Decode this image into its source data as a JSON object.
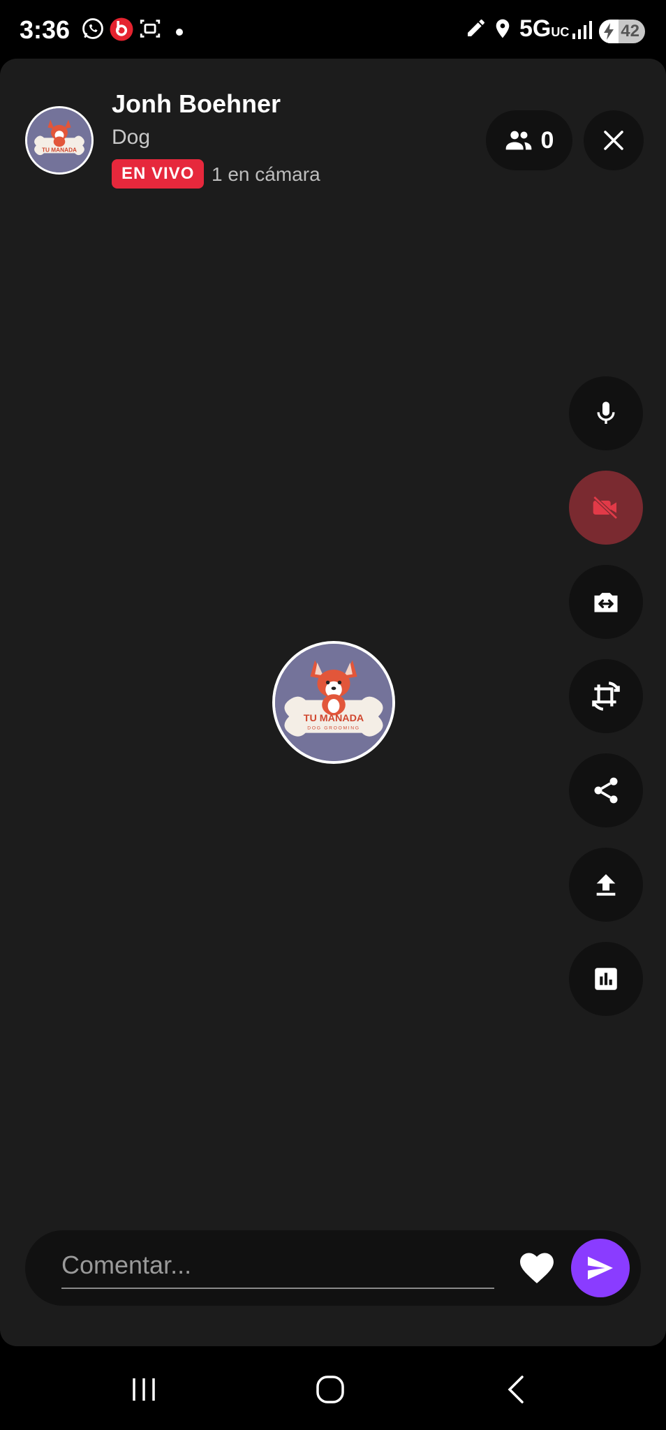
{
  "status_bar": {
    "time": "3:36",
    "network": "5G",
    "network_sub": "UC",
    "battery_level": "42",
    "battery_fraction": 0.42
  },
  "header": {
    "host_name": "Jonh Boehner",
    "host_category": "Dog",
    "live_label": "EN VIVO",
    "camera_count": "1 en cámara",
    "viewer_count": "0"
  },
  "logo": {
    "brand": "TU MANADA",
    "tagline": "DOG GROOMING"
  },
  "side_controls": [
    {
      "name": "microphone-button",
      "icon": "microphone-icon"
    },
    {
      "name": "camera-off-button",
      "icon": "video-off-icon"
    },
    {
      "name": "switch-camera-button",
      "icon": "camera-switch-icon"
    },
    {
      "name": "rotate-button",
      "icon": "crop-rotate-icon"
    },
    {
      "name": "share-button",
      "icon": "share-icon"
    },
    {
      "name": "upload-button",
      "icon": "upload-icon"
    },
    {
      "name": "stats-button",
      "icon": "bar-chart-icon"
    }
  ],
  "comment": {
    "placeholder": "Comentar..."
  },
  "colors": {
    "accent": "#8a3cff",
    "live": "#e6283c",
    "camera_off": "#7a2a30",
    "panel": "#1c1c1c"
  }
}
